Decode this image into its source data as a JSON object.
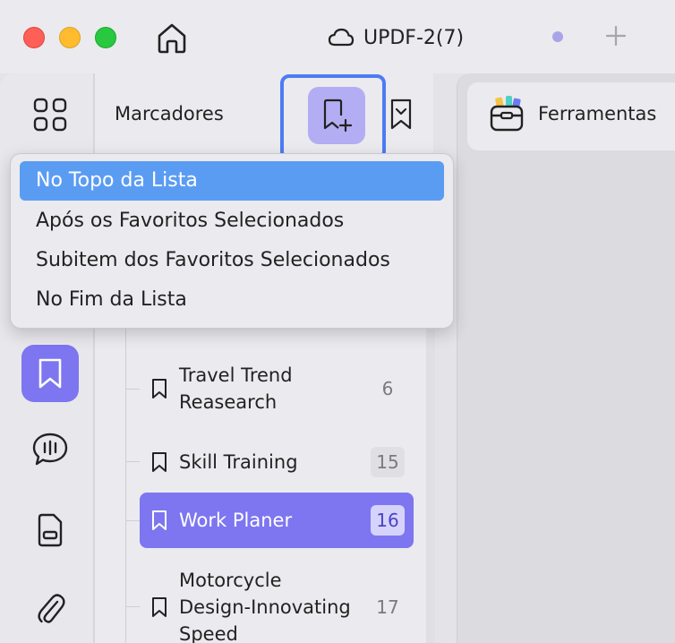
{
  "window": {
    "title": "UPDF-2(7)"
  },
  "sidebar": {
    "title": "Marcadores"
  },
  "menu": {
    "items": [
      {
        "label": "No Topo da Lista"
      },
      {
        "label": "Após os Favoritos Selecionados"
      },
      {
        "label": "Subitem dos Favoritos Selecionados"
      },
      {
        "label": "No Fim da Lista"
      }
    ]
  },
  "bookmarks": {
    "items": [
      {
        "label_line1": "Travel Trend",
        "label_line2": "Reasearch",
        "count": "6"
      },
      {
        "label": "Skill Training",
        "count": "15"
      },
      {
        "label": "Work Planer",
        "count": "16"
      },
      {
        "label_line1": "Motorcycle",
        "label_line2": "Design-Innovating",
        "label_line3": "Speed",
        "count": "17"
      }
    ]
  },
  "tools": {
    "label": "Ferramentas"
  },
  "colors": {
    "accent": "#7d76f0",
    "menu_highlight": "#5b9cf3",
    "focus_ring": "#4c7cf3"
  }
}
